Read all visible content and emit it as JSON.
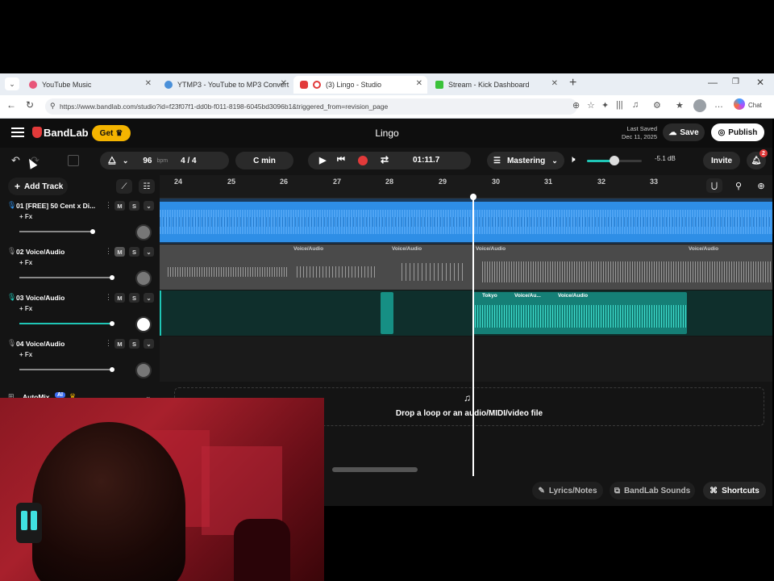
{
  "browser": {
    "tabs": [
      {
        "title": "YouTube Music",
        "color": "#e8567a"
      },
      {
        "title": "YTMP3 - YouTube to MP3 Convert",
        "color": "#4a90d9"
      },
      {
        "title": "(3) Lingo - Studio",
        "color": "#e23a3a"
      },
      {
        "title": "Stream - Kick Dashboard",
        "color": "#3ac23a"
      }
    ],
    "url": "https://www.bandlab.com/studio?id=f23f07f1-dd0b-f011-8198-6045bd3096b1&triggered_from=revision_page",
    "profile_label": "Chat"
  },
  "app": {
    "logo": "BandLab",
    "get_label": "Get",
    "project_title": "Lingo",
    "last_saved_label": "Last Saved",
    "last_saved_date": "Dec 11, 2025",
    "save_label": "Save",
    "publish_label": "Publish",
    "notifications_count": "2"
  },
  "toolbar": {
    "bpm": "96",
    "bpm_unit": "bpm",
    "time_signature": "4 / 4",
    "key": "C min",
    "time": "01:11.7",
    "mastering_label": "Mastering",
    "volume_db": "-5.1 dB",
    "invite_label": "Invite",
    "add_track_label": "Add Track"
  },
  "ruler": {
    "marks": [
      "24",
      "25",
      "26",
      "27",
      "28",
      "29",
      "30",
      "31",
      "32",
      "33"
    ]
  },
  "tracks": [
    {
      "name": "01  [FREE] 50 Cent x Di...",
      "fx": "+ Fx",
      "color": "#2e8ee6",
      "volume": 0.8
    },
    {
      "name": "02  Voice/Audio",
      "fx": "+ Fx",
      "color": "#888888",
      "volume": 0.95
    },
    {
      "name": "03  Voice/Audio",
      "fx": "+ Fx",
      "color": "#1fc6b6",
      "volume": 0.95
    },
    {
      "name": "04  Voice/Audio",
      "fx": "+ Fx",
      "color": "#888888",
      "volume": 0.95
    }
  ],
  "regions": {
    "track2_labels": [
      "Voice/Audio",
      "Voice/Audio",
      "Voice/Audio",
      "Voice/Audio"
    ],
    "track3_labels": [
      "Tokyo",
      "Voice/Au...",
      "Voice/Audio"
    ]
  },
  "automix": {
    "label": "AutoMix",
    "badge": "AI"
  },
  "dropzone": {
    "text": "Drop a loop or an audio/MIDI/video file"
  },
  "footer": {
    "lyrics_label": "Lyrics/Notes",
    "sounds_label": "BandLab Sounds",
    "shortcuts_label": "Shortcuts"
  },
  "colors": {
    "accent": "#e23a3a",
    "gold": "#f4b400",
    "teal": "#1fc6b6",
    "blue": "#2e8ee6"
  }
}
